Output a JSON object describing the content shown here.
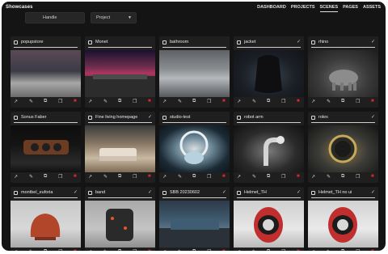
{
  "app": {
    "brand": "Showcases"
  },
  "toolbar": {
    "handle_value": "Handle",
    "project_value": "Project"
  },
  "nav": {
    "items": [
      "DASHBOARD",
      "PROJECTS",
      "SCENES",
      "PAGES",
      "ASSETS"
    ],
    "active": "SCENES"
  },
  "card_actions": {
    "open_icon": "open-external-icon",
    "edit_icon": "edit-pencil-icon",
    "duplicate_icon": "copy-icon",
    "delete_icon": "trash-icon",
    "delete_color": "#e0262b"
  },
  "cards": [
    {
      "name": "popupstore",
      "checked": false
    },
    {
      "name": "Monet",
      "checked": false
    },
    {
      "name": "bathroom",
      "checked": false
    },
    {
      "name": "jacket",
      "checked": true
    },
    {
      "name": "rhino",
      "checked": true
    },
    {
      "name": "Sonus Faber",
      "checked": false
    },
    {
      "name": "Fine living homepage",
      "checked": true
    },
    {
      "name": "studio-test",
      "checked": false
    },
    {
      "name": "robot arm",
      "checked": false
    },
    {
      "name": "rolex",
      "checked": true
    },
    {
      "name": "montbel_euforia",
      "checked": true
    },
    {
      "name": "band",
      "checked": true
    },
    {
      "name": "SBB 20230602",
      "checked": true
    },
    {
      "name": "Helmet_TH",
      "checked": true
    },
    {
      "name": "Helmet_TH no ui",
      "checked": true
    }
  ]
}
